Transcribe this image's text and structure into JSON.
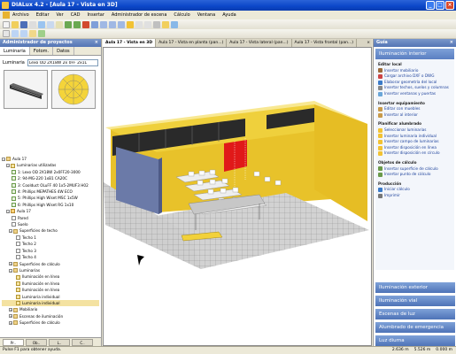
{
  "window": {
    "title": "DIALux 4.2 - [Aula 17 - Vista en 3D]"
  },
  "menu": [
    "Archivo",
    "Editar",
    "Ver",
    "CAD",
    "Insertar",
    "Administrador de escena",
    "Cálculo",
    "Ventana",
    "Ayuda"
  ],
  "left_panel": {
    "title": "Administrador de proyectos",
    "tabs": [
      "Luminaria",
      "Fotom.",
      "Datos"
    ],
    "field_label": "Luminaria",
    "field_value": "Lexo OD 2X18W 2x 0FF 2x1L",
    "tree": [
      "Aula 17",
      "Luminarias utilizadas",
      "1: Lexo OD 2X18W 2x0FF20-3000",
      "2: 94-MG-220 1xB1 CA20C",
      "3: Coolduct OLuFF 40 1x5-2MUF3 H02",
      "4: Phillips MEPATHES 4W ECO",
      "5: Phillips High Wiset MSC 1x5W",
      "6: Phillips High Wiset RG 1x10",
      "Aula 17",
      "Pared",
      "Suelo",
      "Superficies de techo",
      "Techo 1",
      "Techo 2",
      "Techo 3",
      "Techo 4",
      "Superficies de cálculo",
      "Luminarias",
      "Iluminación en línea",
      "Iluminación en línea",
      "Iluminación en línea",
      "Luminaria individual",
      "Luminaria individual",
      "Mobiliario",
      "Escenas de iluminación",
      "Superficies de cálculo"
    ],
    "bottom_tabs": [
      "Pr..",
      "Ob..",
      "L..",
      "C.."
    ]
  },
  "doc_tabs": [
    "Aula 17 - Vista en 3D",
    "Aula 17 - Vista en planta (pan...)",
    "Aula 17 - Vista lateral (pan...)",
    "Aula 17 - Vista frontal (pan...)"
  ],
  "right_panel": {
    "title": "Guía",
    "section": "Iluminación interior",
    "groups": [
      {
        "title": "Editar local",
        "items": [
          "Insertar mobiliario",
          "Cargar archivo DXF o DWG",
          "Elaborar geometría del local",
          "Insertar techos, suelos y columnas",
          "Insertar ventanas y puertas"
        ]
      },
      {
        "title": "Insertar equipamiento",
        "items": [
          "Editar con muebles",
          "Insertar al interior"
        ]
      },
      {
        "title": "Planificar alumbrado",
        "items": [
          "Seleccionar luminarias",
          "Insertar luminaria individual",
          "Insertar campo de luminarias",
          "Insertar disposición en línea",
          "Insertar disposición en círculo"
        ]
      },
      {
        "title": "Objetos de cálculo",
        "items": [
          "Insertar superficie de cálculo",
          "Insertar punto de cálculo"
        ]
      },
      {
        "title": "Producción",
        "items": [
          "Iniciar cálculo",
          "Imprimir"
        ]
      }
    ],
    "buttons": [
      "Iluminación exterior",
      "Iluminación vial",
      "Escenas de luz",
      "Alumbrado de emergencia",
      "Luz diurna"
    ]
  },
  "status": {
    "text": "Pulse F1 para obtener ayuda.",
    "x": "2.636 m",
    "y": "5.526 m",
    "extra": "0.000 m"
  },
  "colors": {
    "accent": "#5a7fc2",
    "walls": "#f1cc2a",
    "floor": "#c8c8c8",
    "board": "#e01919"
  }
}
